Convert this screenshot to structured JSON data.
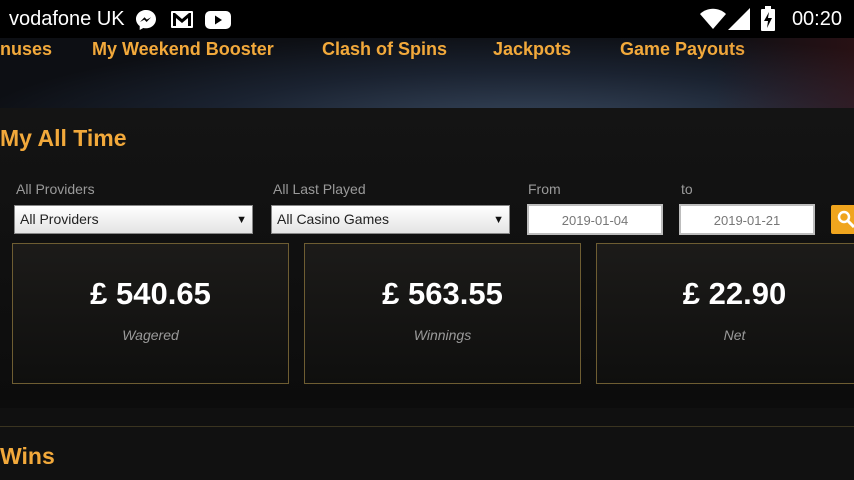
{
  "status_bar": {
    "carrier": "vodafone UK",
    "time": "00:20",
    "icons": [
      "messenger-icon",
      "gmail-icon",
      "youtube-icon",
      "wifi-icon",
      "signal-icon",
      "battery-icon"
    ]
  },
  "nav": {
    "tabs": [
      {
        "label": "nuses"
      },
      {
        "label": "My Weekend Booster"
      },
      {
        "label": "Clash of Spins"
      },
      {
        "label": "Jackpots"
      },
      {
        "label": "Game Payouts"
      }
    ]
  },
  "section": {
    "title": "My All Time",
    "filters": {
      "providers_label": "All Providers",
      "providers_value": "All Providers",
      "played_label": "All Last Played",
      "played_value": "All Casino Games",
      "from_label": "From",
      "from_value": "2019-01-04",
      "to_label": "to",
      "to_value": "2019-01-21"
    },
    "cards": [
      {
        "amount": "£ 540.65",
        "caption": "Wagered"
      },
      {
        "amount": "£ 563.55",
        "caption": "Winnings"
      },
      {
        "amount": "£ 22.90",
        "caption": "Net"
      }
    ]
  },
  "wins": {
    "title": "Wins"
  },
  "colors": {
    "accent": "#f2a93b",
    "button": "#f0a51e"
  }
}
